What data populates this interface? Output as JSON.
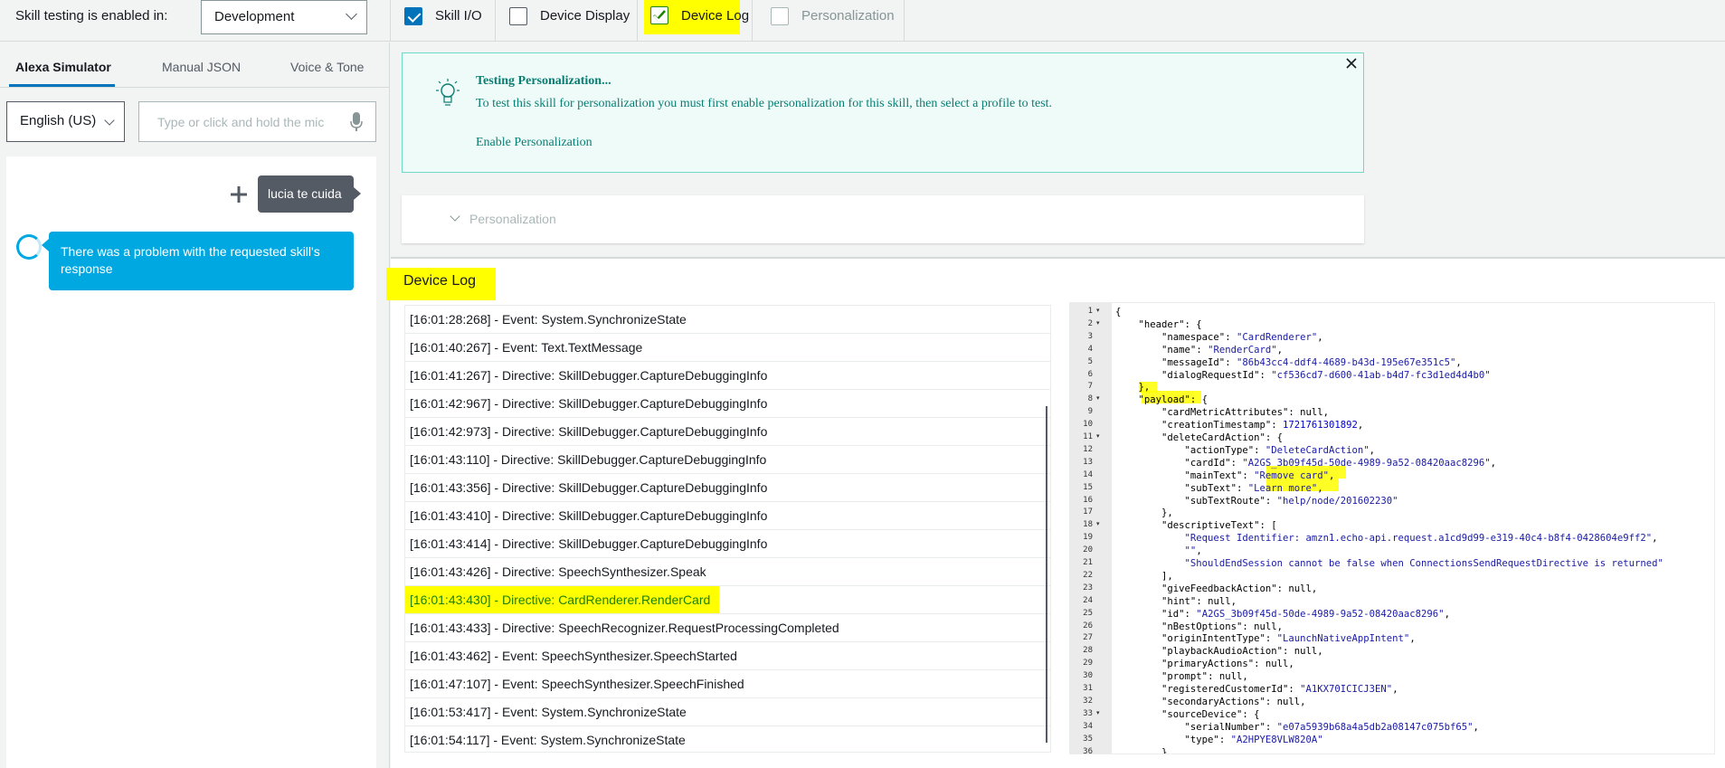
{
  "topbar": {
    "env_label": "Skill testing is enabled in:",
    "env_value": "Development",
    "checkboxes": [
      {
        "label": "Skill I/O",
        "checked": true
      },
      {
        "label": "Device Display",
        "checked": false
      },
      {
        "label": "Device Log",
        "checked": true
      },
      {
        "label": "Personalization",
        "checked": false
      }
    ]
  },
  "left": {
    "tabs": [
      "Alexa Simulator",
      "Manual JSON",
      "Voice & Tone"
    ],
    "language": "English (US)",
    "mic_placeholder": "Type or click and hold the mic",
    "user_message": "lucia te cuida",
    "alexa_message": "There was a problem with the requested skill's response"
  },
  "personalization": {
    "title": "Testing Personalization...",
    "description": "To test this skill for personalization you must first enable personalization for this skill, then select a profile to test.",
    "link": "Enable Personalization",
    "collapse_label": "Personalization"
  },
  "device_log": {
    "title": "Device Log",
    "entries": [
      "[16:01:28:268] - Event: System.SynchronizeState",
      "[16:01:40:267] - Event: Text.TextMessage",
      "[16:01:41:267] - Directive: SkillDebugger.CaptureDebuggingInfo",
      "[16:01:42:967] - Directive: SkillDebugger.CaptureDebuggingInfo",
      "[16:01:42:973] - Directive: SkillDebugger.CaptureDebuggingInfo",
      "[16:01:43:110] - Directive: SkillDebugger.CaptureDebuggingInfo",
      "[16:01:43:356] - Directive: SkillDebugger.CaptureDebuggingInfo",
      "[16:01:43:410] - Directive: SkillDebugger.CaptureDebuggingInfo",
      "[16:01:43:414] - Directive: SkillDebugger.CaptureDebuggingInfo",
      "[16:01:43:426] - Directive: SpeechSynthesizer.Speak",
      "[16:01:43:430] - Directive: CardRenderer.RenderCard",
      "[16:01:43:433] - Directive: SpeechRecognizer.RequestProcessingCompleted",
      "[16:01:43:462] - Event: SpeechSynthesizer.SpeechStarted",
      "[16:01:47:107] - Event: SpeechSynthesizer.SpeechFinished",
      "[16:01:53:417] - Event: System.SynchronizeState",
      "[16:01:54:117] - Event: System.SynchronizeState"
    ],
    "selected_index": 10
  },
  "json_lines": [
    {
      "n": "1",
      "fold": true,
      "text": "{"
    },
    {
      "n": "2",
      "fold": true,
      "text": "    \"header\": {"
    },
    {
      "n": "3",
      "fold": false,
      "text": "        \"namespace\": \"CardRenderer\","
    },
    {
      "n": "4",
      "fold": false,
      "text": "        \"name\": \"RenderCard\","
    },
    {
      "n": "5",
      "fold": false,
      "text": "        \"messageId\": \"86b43cc4-ddf4-4689-b43d-195e67e351c5\","
    },
    {
      "n": "6",
      "fold": false,
      "text": "        \"dialogRequestId\": \"cf536cd7-d600-41ab-b4d7-fc3d1ed4d4b0\""
    },
    {
      "n": "7",
      "fold": false,
      "text": "    },"
    },
    {
      "n": "8",
      "fold": true,
      "text": "    \"payload\": {"
    },
    {
      "n": "9",
      "fold": false,
      "text": "        \"cardMetricAttributes\": null,"
    },
    {
      "n": "10",
      "fold": false,
      "text": "        \"creationTimestamp\": 1721761301892,"
    },
    {
      "n": "11",
      "fold": true,
      "text": "        \"deleteCardAction\": {"
    },
    {
      "n": "12",
      "fold": false,
      "text": "            \"actionType\": \"DeleteCardAction\","
    },
    {
      "n": "13",
      "fold": false,
      "text": "            \"cardId\": \"A2GS_3b09f45d-50de-4989-9a52-08420aac8296\","
    },
    {
      "n": "14",
      "fold": false,
      "text": "            \"mainText\": \"Remove card\","
    },
    {
      "n": "15",
      "fold": false,
      "text": "            \"subText\": \"Learn more\","
    },
    {
      "n": "16",
      "fold": false,
      "text": "            \"subTextRoute\": \"help/node/201602230\""
    },
    {
      "n": "17",
      "fold": false,
      "text": "        },"
    },
    {
      "n": "18",
      "fold": true,
      "text": "        \"descriptiveText\": ["
    },
    {
      "n": "19",
      "fold": false,
      "text": "            \"Request Identifier: amzn1.echo-api.request.a1cd9d99-e319-40c4-b8f4-0428604e9ff2\","
    },
    {
      "n": "20",
      "fold": false,
      "text": "            \"\","
    },
    {
      "n": "21",
      "fold": false,
      "text": "            \"ShouldEndSession cannot be false when ConnectionsSendRequestDirective is returned\""
    },
    {
      "n": "22",
      "fold": false,
      "text": "        ],"
    },
    {
      "n": "23",
      "fold": false,
      "text": "        \"giveFeedbackAction\": null,"
    },
    {
      "n": "24",
      "fold": false,
      "text": "        \"hint\": null,"
    },
    {
      "n": "25",
      "fold": false,
      "text": "        \"id\": \"A2GS_3b09f45d-50de-4989-9a52-08420aac8296\","
    },
    {
      "n": "26",
      "fold": false,
      "text": "        \"nBestOptions\": null,"
    },
    {
      "n": "27",
      "fold": false,
      "text": "        \"originIntentType\": \"LaunchNativeAppIntent\","
    },
    {
      "n": "28",
      "fold": false,
      "text": "        \"playbackAudioAction\": null,"
    },
    {
      "n": "29",
      "fold": false,
      "text": "        \"primaryActions\": null,"
    },
    {
      "n": "30",
      "fold": false,
      "text": "        \"prompt\": null,"
    },
    {
      "n": "31",
      "fold": false,
      "text": "        \"registeredCustomerId\": \"A1KX70ICICJ3EN\","
    },
    {
      "n": "32",
      "fold": false,
      "text": "        \"secondaryActions\": null,"
    },
    {
      "n": "33",
      "fold": true,
      "text": "        \"sourceDevice\": {"
    },
    {
      "n": "34",
      "fold": false,
      "text": "            \"serialNumber\": \"e07a5939b68a4a5db2a08147c075bf65\","
    },
    {
      "n": "35",
      "fold": false,
      "text": "            \"type\": \"A2HPYE8VLW820A\""
    },
    {
      "n": "36",
      "fold": false,
      "text": "        }"
    }
  ],
  "colors": {
    "accent": "#0073bb",
    "highlight": "#ffff00",
    "alexa_bubble": "#00a8e1",
    "user_bubble": "#545b64",
    "json_string": "#1a1aa6"
  }
}
